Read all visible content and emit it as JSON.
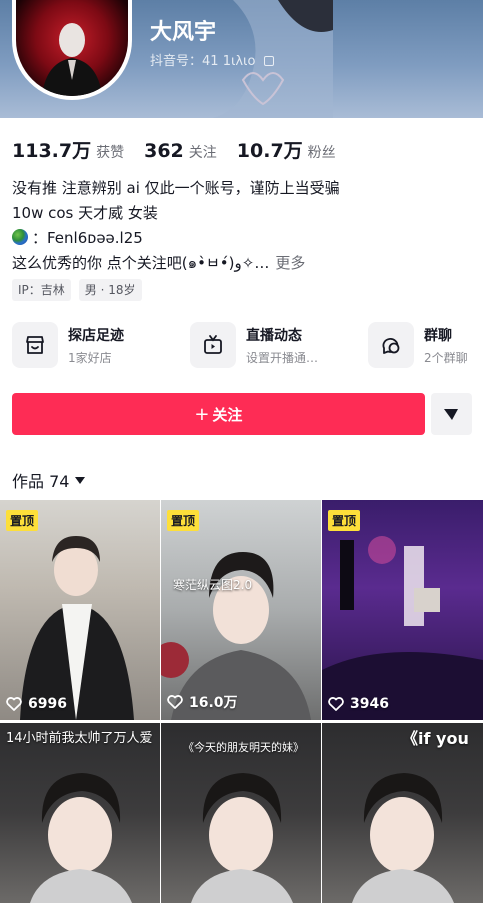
{
  "profile": {
    "name": "大风宇",
    "uid_label": "抖音号：41",
    "uid_tail": "1ιλιο"
  },
  "stats": [
    {
      "value": "113.7万",
      "label": "获赞"
    },
    {
      "value": "362",
      "label": "关注"
    },
    {
      "value": "10.7万",
      "label": "粉丝"
    }
  ],
  "bio": {
    "line1": "没有推 注意辨别 ai 仅此一个账号，谨防上当受骗",
    "line2": "10w cos 天才威 女装",
    "line3": "：Fenl6ᴅəə.l25",
    "line4": "这么优秀的你 点个关注吧(๑•̀ㅂ•́)و✧…",
    "more": "更多"
  },
  "tags": [
    "IP：吉林",
    "男 · 18岁"
  ],
  "services": [
    {
      "title": "探店足迹",
      "subtitle": "1家好店",
      "icon": "store-icon"
    },
    {
      "title": "直播动态",
      "subtitle": "设置开播通…",
      "icon": "tv-icon"
    },
    {
      "title": "群聊",
      "subtitle": "2个群聊",
      "icon": "chat-bubbles-icon"
    }
  ],
  "actions": {
    "follow_plus": "+",
    "follow_label": "关注"
  },
  "works_tab": {
    "label": "作品 74"
  },
  "videos": [
    {
      "pinned": "置顶",
      "likes": "6996",
      "overlay": ""
    },
    {
      "pinned": "置顶",
      "likes": "16.0万",
      "overlay": "寒茫纵云图2.0"
    },
    {
      "pinned": "置顶",
      "likes": "3946",
      "overlay": ""
    },
    {
      "pinned": "",
      "likes": "",
      "overlay": "14小时前我太帅了万人爱"
    },
    {
      "pinned": "",
      "likes": "",
      "overlay": "《今天的朋友明天的妹》"
    },
    {
      "pinned": "",
      "likes": "",
      "overlay": "《if you"
    }
  ],
  "colors": {
    "accent": "#fe2c55",
    "pin": "#fddf3a",
    "header": "#7f9cc0"
  }
}
